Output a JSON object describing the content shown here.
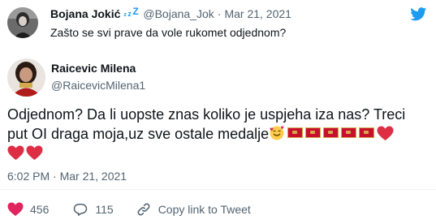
{
  "replied_to": {
    "name": "Bojana Jokić",
    "sleep_glyph_large": "Z",
    "sleep_glyph_small": "z",
    "handle": "@Bojana_Jok",
    "separator": "·",
    "date": "Mar 21, 2021",
    "text": "Zašto se svi prave da vole rukomet odjednom?",
    "avatar_icon": "profile-photo"
  },
  "tweet": {
    "name": "Raicevic Milena",
    "handle": "@RaicevicMilena1",
    "line1": "Odjednom? Da li uopste znas koliko je uspjeha iza nas? Treci",
    "line2_text": "put OI draga moja,uz sve ostale medalje",
    "emoji_icons": [
      "smiling-face-with-hearts-icon",
      "montenegro-flag-icon",
      "montenegro-flag-icon",
      "montenegro-flag-icon",
      "montenegro-flag-icon",
      "montenegro-flag-icon",
      "red-heart-icon",
      "red-heart-icon",
      "red-heart-icon"
    ],
    "timestamp": "6:02 PM · Mar 21, 2021",
    "avatar_icon": "profile-photo"
  },
  "actions": {
    "likes": "456",
    "replies": "115",
    "copy_link_label": "Copy link to Tweet"
  },
  "colors": {
    "text": "#0f1419",
    "secondary": "#536471",
    "twitter_blue": "#1d9bf0",
    "heart_red": "#e0245e",
    "divider": "#eff3f4"
  }
}
